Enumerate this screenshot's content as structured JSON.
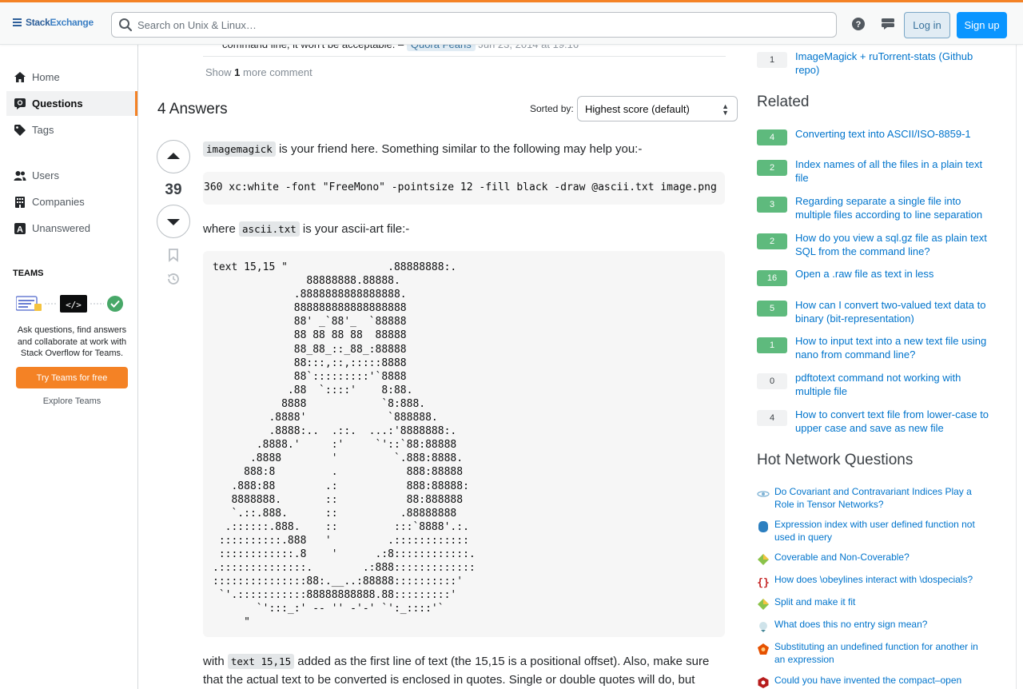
{
  "header": {
    "logo_main": "Stack",
    "logo_accent": "Exchange",
    "search_placeholder": "Search on Unix & Linux…",
    "login_label": "Log in",
    "signup_label": "Sign up"
  },
  "sidebar": {
    "items": [
      {
        "label": "Home",
        "icon": "home-icon"
      },
      {
        "label": "Questions",
        "icon": "questions-icon",
        "active": true
      },
      {
        "label": "Tags",
        "icon": "tag-icon"
      },
      {
        "label": "Users",
        "icon": "users-icon"
      },
      {
        "label": "Companies",
        "icon": "companies-icon"
      },
      {
        "label": "Unanswered",
        "icon": "unanswered-icon"
      }
    ],
    "teams_heading": "TEAMS",
    "teams_text": "Ask questions, find answers and collaborate at work with Stack Overflow for Teams.",
    "teams_button": "Try Teams for free",
    "teams_explore": "Explore Teams"
  },
  "question_comment": {
    "text": "command line, it won't be acceptable. –",
    "user": "Quora Feans",
    "time": "Jun 23, 2014 at 19:16"
  },
  "show_comments": {
    "prefix": "Show",
    "count": "1",
    "suffix": "more comment"
  },
  "answers": {
    "heading": "4 Answers",
    "sorted_label": "Sorted by:",
    "sort_value": "Highest score (default)"
  },
  "answer": {
    "score": "39",
    "p1_code": "imagemagick",
    "p1_text": " is your friend here. Something similar to the following may help you:-",
    "command": "360 xc:white -font \"FreeMono\" -pointsize 12 -fill black -draw @ascii.txt image.png",
    "p2_prefix": "where ",
    "p2_code": "ascii.txt",
    "p2_text": " is your ascii-art file:-",
    "ascii_art": "text 15,15 \"                .88888888:.\n               88888888.88888.\n             .8888888888888888.\n             888888888888888888\n             88' _`88'_  `88888\n             88 88 88 88  88888\n             88_88_::_88_:88888\n             88:::,::,:::::8888\n             88`:::::::::'`8888\n            .88  `::::'    8:88.\n           8888            `8:888.\n         .8888'             `888888.\n         .8888:..  .::.  ...:'8888888:.\n       .8888.'     :'     `'::`88:88888\n      .8888        '         `.888:8888.\n     888:8         .           888:88888\n   .888:88        .:           888:88888:\n   8888888.       ::           88:888888\n   `.::.888.      ::          .88888888\n  .::::::.888.    ::         :::`8888'.:.\n ::::::::::.888   '         .::::::::::::\n ::::::::::::.8    '      .:8::::::::::::.\n.::::::::::::::.        .:888:::::::::::::\n:::::::::::::::88:.__..:88888::::::::::'\n `'.:::::::::::88888888888.88:::::::::'\n       `':::_:' -- '' -'-' `':_::::'`\n     \"",
    "p3_prefix": "with ",
    "p3_code": "text 15,15",
    "p3_text": " added as the first line of text (the 15,15 is a positional offset). Also, make sure",
    "p4_text": "that the actual text to be converted is enclosed in quotes. Single or double quotes will do, but"
  },
  "linked": [
    {
      "score": "1",
      "title": "ImageMagick + ruTorrent-stats (Github repo)"
    }
  ],
  "related": {
    "heading": "Related",
    "items": [
      {
        "score": "4",
        "title": "Converting text into ASCII/ISO-8859-1"
      },
      {
        "score": "2",
        "title": "Index names of all the files in a plain text file"
      },
      {
        "score": "3",
        "title": "Regarding separate a single file into multiple files according to line separation"
      },
      {
        "score": "2",
        "title": "How do you view a sql.gz file as plain text SQL from the command line?"
      },
      {
        "score": "16",
        "title": "Open a .raw file as text in less"
      },
      {
        "score": "5",
        "title": "How can I convert two-valued text data to binary (bit-representation)"
      },
      {
        "score": "1",
        "title": "How to input text into a new text file using nano from command line?"
      },
      {
        "score": "0",
        "title": "pdftotext command not working with multiple file"
      },
      {
        "score": "4",
        "title": "How to convert text file from lower-case to upper case and save as new file"
      }
    ]
  },
  "hnq": {
    "heading": "Hot Network Questions",
    "items": [
      {
        "title": "Do Covariant and Contravariant Indices Play a Role in Tensor Networks?",
        "icon": "physics-site-icon",
        "color": "#7fb3d5"
      },
      {
        "title": "Expression index with user defined function not used in query",
        "icon": "dba-site-icon",
        "color": "#2c7fc0"
      },
      {
        "title": "Coverable and Non-Coverable?",
        "icon": "puzzling-site-icon",
        "color": "#8bc34a"
      },
      {
        "title": "How does \\obeylines interact with \\dospecials?",
        "icon": "tex-site-icon",
        "color": "#c62828"
      },
      {
        "title": "Split and make it fit",
        "icon": "puzzling-site-icon",
        "color": "#8bc34a"
      },
      {
        "title": "What does this no entry sign mean?",
        "icon": "travel-site-icon",
        "color": "#4a8a9a"
      },
      {
        "title": "Substituting an undefined function for another in an expression",
        "icon": "mathematica-site-icon",
        "color": "#e65100"
      },
      {
        "title": "Could you have invented the compact–open",
        "icon": "math-site-icon",
        "color": "#b71c1c"
      }
    ]
  }
}
